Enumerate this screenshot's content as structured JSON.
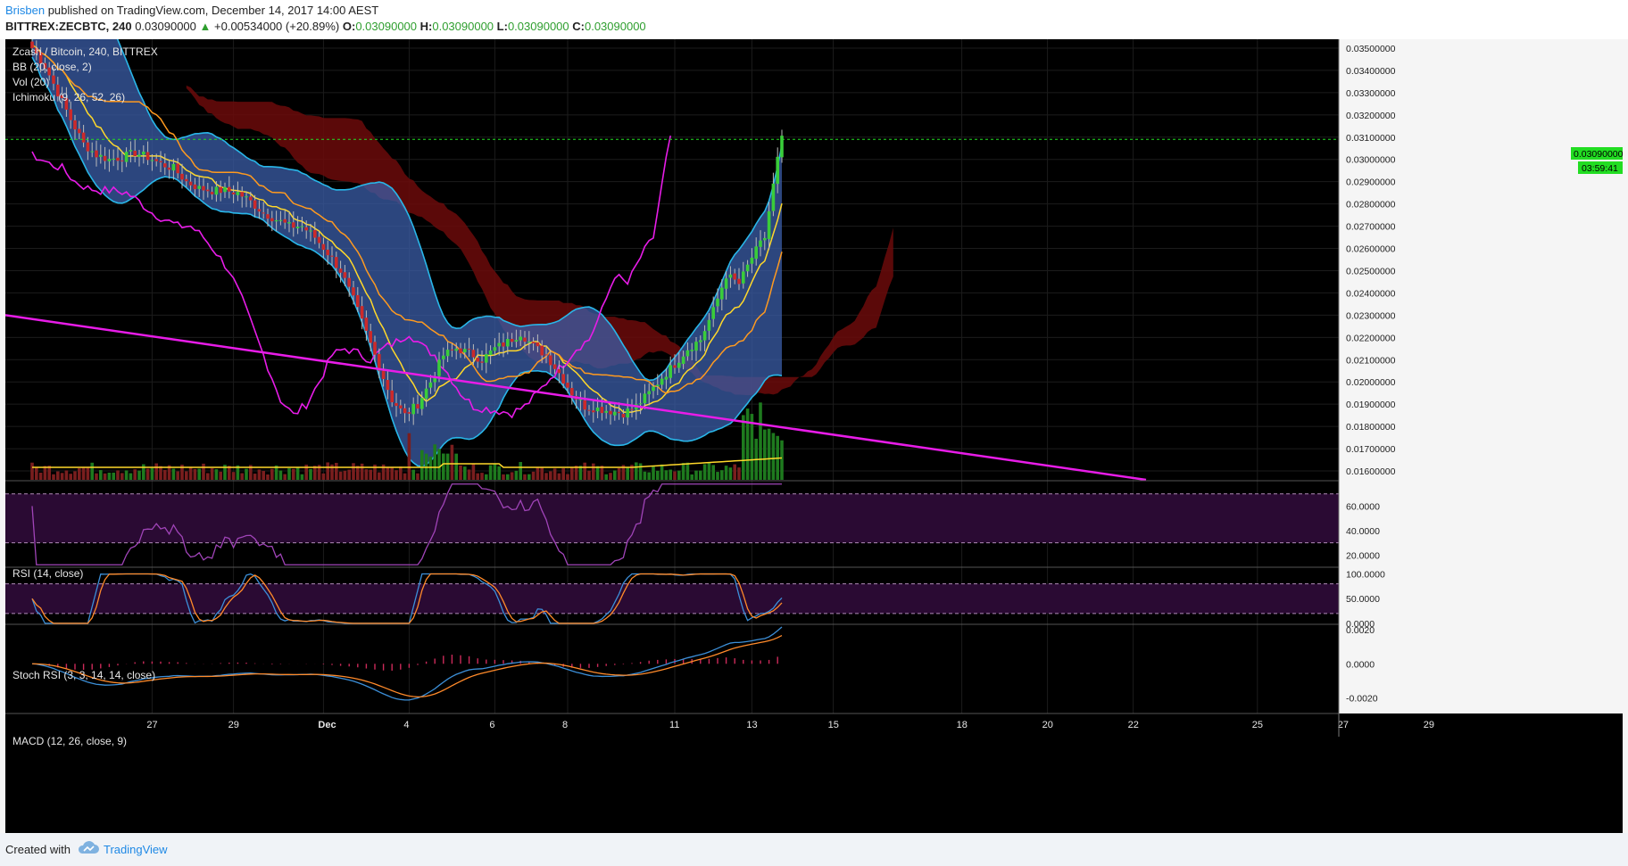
{
  "header": {
    "author": "Brisben",
    "published": "published on TradingView.com, December 14, 2017 14:00 AEST",
    "symbol": "BITTREX:ZECBTC, 240",
    "last": "0.03090000",
    "change_arrow": "▲",
    "change": "+0.00534000 (+20.89%)",
    "o_label": "O:",
    "o_value": "0.03090000",
    "h_label": "H:",
    "h_value": "0.03090000",
    "l_label": "L:",
    "l_value": "0.03090000",
    "c_label": "C:",
    "c_value": "0.03090000"
  },
  "legend": {
    "title": "Zcash / Bitcoin, 240, BITTREX",
    "bb": "BB (20, close, 2)",
    "vol": "Vol (20)",
    "ichimoku": "Ichimoku (9, 26, 52, 26)"
  },
  "price_label": "0.03090000",
  "countdown": "03:59:41",
  "footer": {
    "created": "Created with",
    "brand": "TradingView"
  },
  "colors": {
    "background": "#000000",
    "candle_up": "#3acc3a",
    "candle_down": "#cc2a2a",
    "bb_fill": "#3b5ea8",
    "bb_line": "#29b6e8",
    "cloud_bear": "#6b0b0b",
    "cloud_bull": "#1f5c1f",
    "tenkan": "#ffd82a",
    "kijun": "#ff9a1f",
    "chikou": "#e81ce8",
    "trendline": "#e81ce8",
    "price_line": "#22dd22",
    "rsi": "#a044b8",
    "stoch_k": "#3c8fd8",
    "stoch_d": "#ff8a2a",
    "macd": "#3c8fd8",
    "macd_signal": "#ff8a2a",
    "macd_hist": "#cc2a5a"
  },
  "chart_data": [
    {
      "type": "candlestick",
      "title": "Zcash / Bitcoin, 240, BITTREX",
      "y_ticks": [
        "0.01600000",
        "0.01700000",
        "0.01800000",
        "0.01900000",
        "0.02000000",
        "0.02100000",
        "0.02200000",
        "0.02300000",
        "0.02400000",
        "0.02500000",
        "0.02600000",
        "0.02700000",
        "0.02800000",
        "0.02900000",
        "0.03000000",
        "0.03100000",
        "0.03200000",
        "0.03300000",
        "0.03400000",
        "0.03500000"
      ],
      "ylim": [
        0.0156,
        0.0354
      ],
      "x_ticks": [
        "27",
        "29",
        "Dec",
        "4",
        "6",
        "8",
        "11",
        "13",
        "15",
        "18",
        "20",
        "22",
        "25",
        "27",
        "29"
      ],
      "close_points": [
        [
          0,
          0.035
        ],
        [
          3,
          0.0342
        ],
        [
          6,
          0.033
        ],
        [
          9,
          0.0318
        ],
        [
          12,
          0.0307
        ],
        [
          15,
          0.0302
        ],
        [
          18,
          0.03
        ],
        [
          21,
          0.0301
        ],
        [
          24,
          0.0303
        ],
        [
          27,
          0.0301
        ],
        [
          30,
          0.0298
        ],
        [
          33,
          0.0296
        ],
        [
          36,
          0.029
        ],
        [
          39,
          0.0287
        ],
        [
          42,
          0.0286
        ],
        [
          45,
          0.0286
        ],
        [
          48,
          0.0285
        ],
        [
          51,
          0.0281
        ],
        [
          54,
          0.0276
        ],
        [
          57,
          0.0273
        ],
        [
          60,
          0.027
        ],
        [
          63,
          0.027
        ],
        [
          66,
          0.0265
        ],
        [
          69,
          0.0258
        ],
        [
          72,
          0.025
        ],
        [
          75,
          0.0237
        ],
        [
          78,
          0.0222
        ],
        [
          81,
          0.0207
        ],
        [
          84,
          0.0192
        ],
        [
          87,
          0.0185
        ],
        [
          90,
          0.019
        ],
        [
          93,
          0.02
        ],
        [
          96,
          0.0212
        ],
        [
          99,
          0.0215
        ],
        [
          102,
          0.0213
        ],
        [
          105,
          0.021
        ],
        [
          108,
          0.0215
        ],
        [
          111,
          0.0218
        ],
        [
          114,
          0.0222
        ],
        [
          117,
          0.0216
        ],
        [
          120,
          0.0212
        ],
        [
          123,
          0.0204
        ],
        [
          126,
          0.0195
        ],
        [
          129,
          0.0189
        ],
        [
          132,
          0.0188
        ],
        [
          135,
          0.0187
        ],
        [
          138,
          0.0186
        ],
        [
          141,
          0.0189
        ],
        [
          144,
          0.0195
        ],
        [
          147,
          0.0202
        ],
        [
          150,
          0.0208
        ],
        [
          153,
          0.0215
        ],
        [
          156,
          0.0219
        ],
        [
          159,
          0.0232
        ],
        [
          162,
          0.0248
        ],
        [
          165,
          0.0244
        ],
        [
          168,
          0.0256
        ],
        [
          171,
          0.0265
        ],
        [
          174,
          0.03
        ],
        [
          175,
          0.0309
        ]
      ],
      "volume_scale": "relative",
      "support_trendline": {
        "from": [
          0,
          0.023
        ],
        "to": [
          260,
          0.0156
        ]
      }
    },
    {
      "type": "line",
      "title": "RSI (14, close)",
      "y_ticks": [
        "20.0000",
        "40.0000",
        "60.0000"
      ],
      "ylim": [
        10,
        80
      ],
      "bands": [
        30,
        70
      ]
    },
    {
      "type": "line",
      "title": "Stoch RSI (3, 3, 14, 14, close)",
      "y_ticks": [
        "0.0000",
        "50.0000",
        "100.0000"
      ],
      "ylim": [
        -2,
        110
      ],
      "bands": [
        20,
        80
      ]
    },
    {
      "type": "line",
      "title": "MACD (12, 26, close, 9)",
      "y_ticks": [
        "-0.0020",
        "0.0000",
        "0.0020"
      ],
      "ylim": [
        -0.0029,
        0.0022
      ]
    }
  ]
}
